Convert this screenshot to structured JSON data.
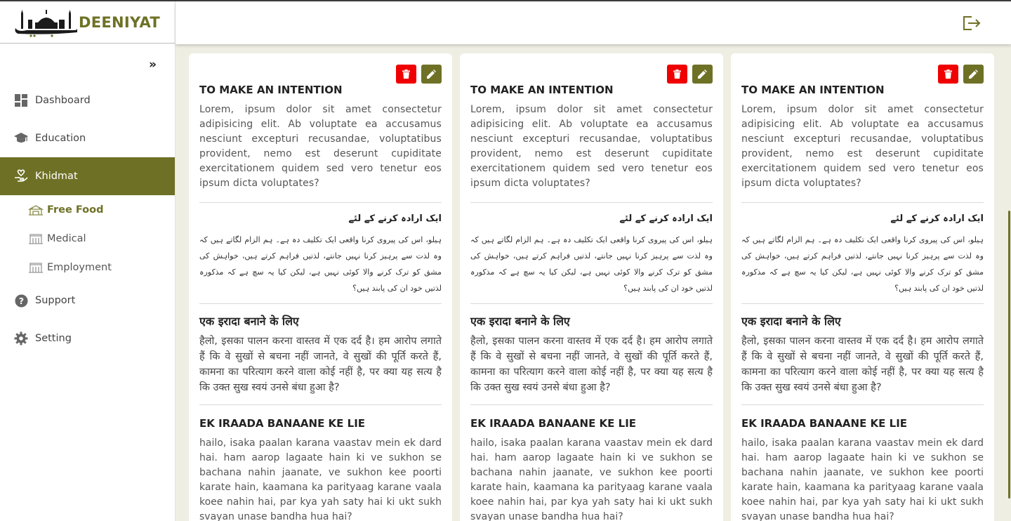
{
  "brand": {
    "name": "DEENIYAT",
    "accent": "#6e7125"
  },
  "sidebar": {
    "collapse_label": "»",
    "items": [
      {
        "label": "Dashboard",
        "icon": "dashboard-icon"
      },
      {
        "label": "Education",
        "icon": "graduation-cap-icon"
      },
      {
        "label": "Khidmat",
        "icon": "hand-heart-icon",
        "active": true
      },
      {
        "label": "Support",
        "icon": "question-icon"
      },
      {
        "label": "Setting",
        "icon": "gear-icon"
      }
    ],
    "subitems": [
      {
        "label": "Free Food",
        "icon": "building-icon",
        "active": true
      },
      {
        "label": "Medical",
        "icon": "building-icon"
      },
      {
        "label": "Employment",
        "icon": "building-icon"
      }
    ]
  },
  "header": {
    "logout_icon": "logout-icon"
  },
  "cards": [
    {
      "en_title": "TO MAKE AN INTENTION",
      "en_text": "Lorem, ipsum dolor sit amet consectetur adipisicing elit. Ab voluptate ea accusamus nesciunt excepturi recusandae, voluptatibus provident, nemo est deserunt cupiditate exercitationem quidem sed vero tenetur eos ipsum dicta voluptates?",
      "ur_title": "ایک ارادہ کرنے کے لئے",
      "ur_text": "ہیلو، اس کی پیروی کرنا واقعی ایک تکلیف دہ ہے۔ ہم الزام لگاتے ہیں کہ وہ لذت سے پرہیز کرنا نہیں جانتے، لذتیں فراہم کرتے ہیں، خواہش کی مشق کو ترک کرنے والا کوئی نہیں ہے، لیکن کیا یہ سچ ہے کہ مذکورہ لذتیں خود ان کی پابند ہیں؟",
      "hi_title": "एक इरादा बनाने के लिए",
      "hi_text": "हैलो, इसका पालन करना वास्तव में एक दर्द है। हम आरोप लगाते हैं कि वे सुखों से बचना नहीं जानते, वे सुखों की पूर्ति करते हैं, कामना का परित्याग करने वाला कोई नहीं है, पर क्या यह सत्य है कि उक्त सुख स्वयं उनसे बंधा हुआ है?",
      "tr_title": "EK IRAADA BANAANE KE LIE",
      "tr_text": "hailo, isaka paalan karana vaastav mein ek dard hai. ham aarop lagaate hain ki ve sukhon se bachana nahin jaanate, ve sukhon kee poorti karate hain, kaamana ka parityaag karane vaala koee nahin hai, par kya yah saty hai ki ukt sukh svayan unase bandha hua hai?"
    },
    {
      "en_title": "TO MAKE AN INTENTION",
      "en_text": "Lorem, ipsum dolor sit amet consectetur adipisicing elit. Ab voluptate ea accusamus nesciunt excepturi recusandae, voluptatibus provident, nemo est deserunt cupiditate exercitationem quidem sed vero tenetur eos ipsum dicta voluptates?",
      "ur_title": "ایک ارادہ کرنے کے لئے",
      "ur_text": "ہیلو، اس کی پیروی کرنا واقعی ایک تکلیف دہ ہے۔ ہم الزام لگاتے ہیں کہ وہ لذت سے پرہیز کرنا نہیں جانتے، لذتیں فراہم کرتے ہیں، خواہش کی مشق کو ترک کرنے والا کوئی نہیں ہے، لیکن کیا یہ سچ ہے کہ مذکورہ لذتیں خود ان کی پابند ہیں؟",
      "hi_title": "एक इरादा बनाने के लिए",
      "hi_text": "हैलो, इसका पालन करना वास्तव में एक दर्द है। हम आरोप लगाते हैं कि वे सुखों से बचना नहीं जानते, वे सुखों की पूर्ति करते हैं, कामना का परित्याग करने वाला कोई नहीं है, पर क्या यह सत्य है कि उक्त सुख स्वयं उनसे बंधा हुआ है?",
      "tr_title": "EK IRAADA BANAANE KE LIE",
      "tr_text": "hailo, isaka paalan karana vaastav mein ek dard hai. ham aarop lagaate hain ki ve sukhon se bachana nahin jaanate, ve sukhon kee poorti karate hain, kaamana ka parityaag karane vaala koee nahin hai, par kya yah saty hai ki ukt sukh svayan unase bandha hua hai?"
    },
    {
      "en_title": "TO MAKE AN INTENTION",
      "en_text": "Lorem, ipsum dolor sit amet consectetur adipisicing elit. Ab voluptate ea accusamus nesciunt excepturi recusandae, voluptatibus provident, nemo est deserunt cupiditate exercitationem quidem sed vero tenetur eos ipsum dicta voluptates?",
      "ur_title": "ایک ارادہ کرنے کے لئے",
      "ur_text": "ہیلو، اس کی پیروی کرنا واقعی ایک تکلیف دہ ہے۔ ہم الزام لگاتے ہیں کہ وہ لذت سے پرہیز کرنا نہیں جانتے، لذتیں فراہم کرتے ہیں، خواہش کی مشق کو ترک کرنے والا کوئی نہیں ہے، لیکن کیا یہ سچ ہے کہ مذکورہ لذتیں خود ان کی پابند ہیں؟",
      "hi_title": "एक इरादा बनाने के लिए",
      "hi_text": "हैलो, इसका पालन करना वास्तव में एक दर्द है। हम आरोप लगाते हैं कि वे सुखों से बचना नहीं जानते, वे सुखों की पूर्ति करते हैं, कामना का परित्याग करने वाला कोई नहीं है, पर क्या यह सत्य है कि उक्त सुख स्वयं उनसे बंधा हुआ है?",
      "tr_title": "EK IRAADA BANAANE KE LIE",
      "tr_text": "hailo, isaka paalan karana vaastav mein ek dard hai. ham aarop lagaate hain ki ve sukhon se bachana nahin jaanate, ve sukhon kee poorti karate hain, kaamana ka parityaag karane vaala koee nahin hai, par kya yah saty hai ki ukt sukh svayan unase bandha hua hai?"
    }
  ]
}
